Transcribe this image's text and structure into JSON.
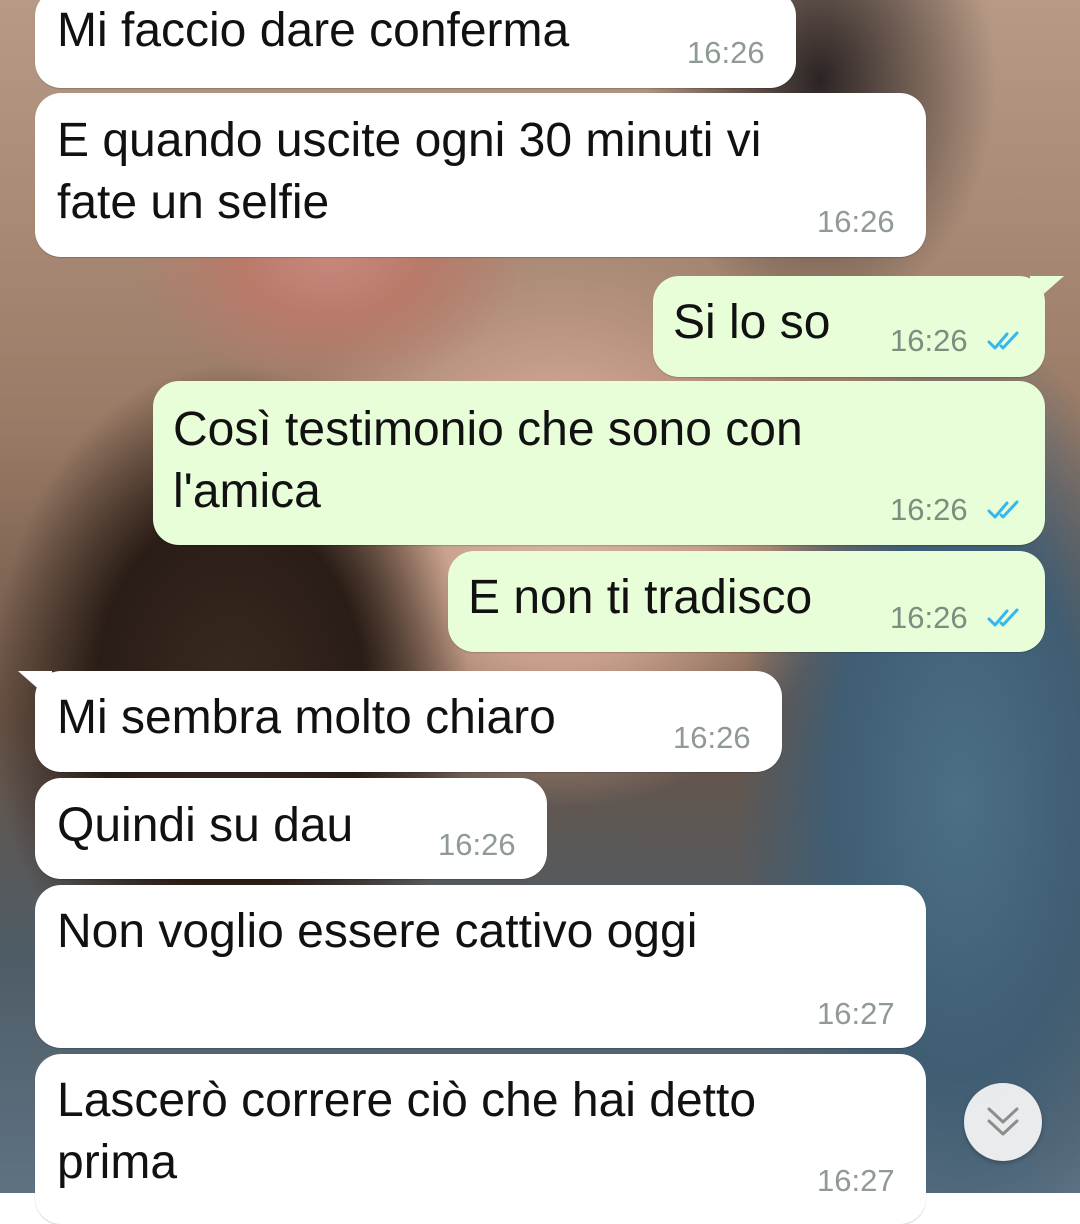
{
  "messages": [
    {
      "id": "m1",
      "direction": "in",
      "text": "Mi faccio dare conferma",
      "time": "16:26"
    },
    {
      "id": "m2",
      "direction": "in",
      "text": "E quando uscite ogni 30 minuti vi\nfate un selfie",
      "time": "16:26"
    },
    {
      "id": "m3",
      "direction": "out",
      "text": "Si lo so",
      "time": "16:26",
      "status": "read"
    },
    {
      "id": "m4",
      "direction": "out",
      "text": "Così testimonio che sono con\nl'amica",
      "time": "16:26",
      "status": "read"
    },
    {
      "id": "m5",
      "direction": "out",
      "text": "E non ti tradisco",
      "time": "16:26",
      "status": "read"
    },
    {
      "id": "m6",
      "direction": "in",
      "text": "Mi sembra molto chiaro",
      "time": "16:26"
    },
    {
      "id": "m7",
      "direction": "in",
      "text": "Quindi su dau",
      "time": "16:26"
    },
    {
      "id": "m8",
      "direction": "in",
      "text": "Non voglio essere cattivo oggi",
      "time": "16:27"
    },
    {
      "id": "m9",
      "direction": "in",
      "text": "Lascerò correre ciò che hai detto\nprima",
      "time": "16:27"
    }
  ],
  "colors": {
    "incoming_bubble": "#ffffff",
    "outgoing_bubble": "#e7fed8",
    "read_ticks": "#34b7f1",
    "timestamp": "#8f9a93"
  },
  "icons": {
    "read_receipt": "double-check-icon",
    "scroll_down": "double-chevron-down-icon"
  }
}
